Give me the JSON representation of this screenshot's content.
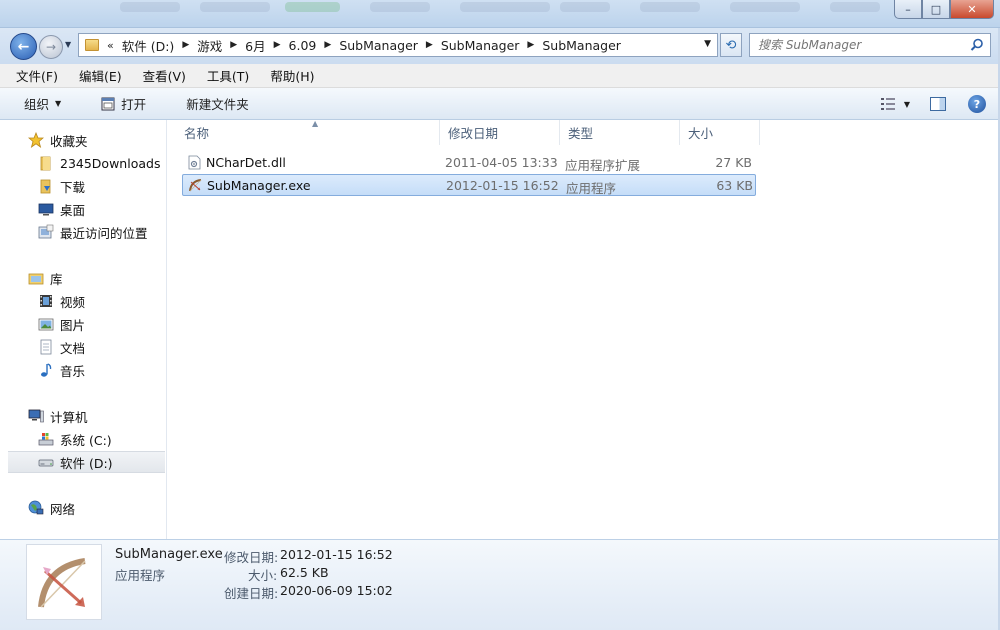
{
  "window": {
    "minimize_glyph": "–",
    "maximize_glyph": "□",
    "close_glyph": "✕"
  },
  "nav": {
    "back_glyph": "←",
    "forward_glyph": "→",
    "overflow": "«",
    "breadcrumbs": [
      "软件 (D:)",
      "游戏",
      "6月",
      "6.09",
      "SubManager",
      "SubManager",
      "SubManager"
    ],
    "search_placeholder": "搜索 SubManager"
  },
  "menu": [
    "文件(F)",
    "编辑(E)",
    "查看(V)",
    "工具(T)",
    "帮助(H)"
  ],
  "toolbar": {
    "organize": "组织",
    "open": "打开",
    "new_folder": "新建文件夹",
    "help": "?"
  },
  "sidebar": {
    "favorites": {
      "label": "收藏夹",
      "items": [
        "2345Downloads",
        "下载",
        "桌面",
        "最近访问的位置"
      ]
    },
    "libraries": {
      "label": "库",
      "items": [
        "视频",
        "图片",
        "文档",
        "音乐"
      ]
    },
    "computer": {
      "label": "计算机",
      "items": [
        "系统 (C:)",
        "软件 (D:)"
      ]
    },
    "network": {
      "label": "网络"
    }
  },
  "columns": {
    "name": "名称",
    "modified": "修改日期",
    "type": "类型",
    "size": "大小"
  },
  "files": [
    {
      "name": "NCharDet.dll",
      "modified": "2011-04-05 13:33",
      "type": "应用程序扩展",
      "size": "27 KB",
      "icon": "dll-file-icon"
    },
    {
      "name": "SubManager.exe",
      "modified": "2012-01-15 16:52",
      "type": "应用程序",
      "size": "63 KB",
      "icon": "bow-arrow-app-icon"
    }
  ],
  "details": {
    "name": "SubManager.exe",
    "type": "应用程序",
    "modified_label": "修改日期:",
    "modified": "2012-01-15 16:52",
    "size_label": "大小:",
    "size": "62.5 KB",
    "created_label": "创建日期:",
    "created": "2020-06-09 15:02"
  },
  "colors": {
    "selection": "#cde4fb",
    "selection_border": "#84acdd",
    "header_text": "#4c607a",
    "secondary_text": "#6d6d6d"
  }
}
